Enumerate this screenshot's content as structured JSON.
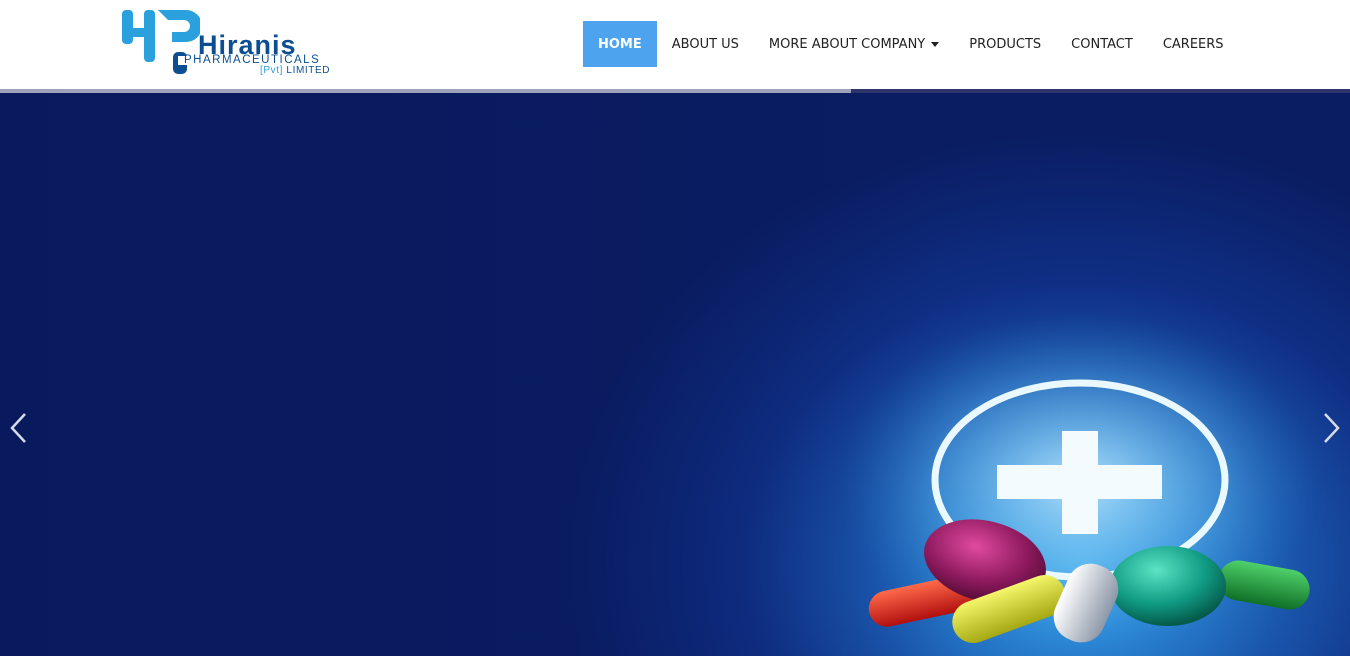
{
  "brand": {
    "name": "Hiranis",
    "subtitle": "PHARMACEUTICALS",
    "subtitle2_pvt": "[Pvt]",
    "subtitle2_rest": "LIMITED",
    "logo_color": "#0b4f92",
    "logo_accent": "#2aa0dc"
  },
  "nav": {
    "items": [
      {
        "label": "HOME",
        "active": true
      },
      {
        "label": "ABOUT US"
      },
      {
        "label": "MORE ABOUT COMPANY",
        "dropdown": true
      },
      {
        "label": "PRODUCTS"
      },
      {
        "label": "CONTACT"
      },
      {
        "label": "CAREERS"
      }
    ],
    "active_color": "#4da3ee"
  },
  "slider": {
    "progress": 0.63,
    "prev_icon": "chevron-left-icon",
    "next_icon": "chevron-right-icon",
    "slide_image": "medical-cross-with-pills"
  }
}
